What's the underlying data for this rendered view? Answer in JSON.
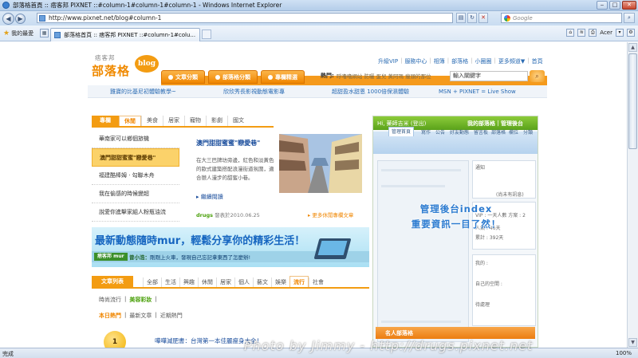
{
  "browser": {
    "title": "部落格首頁 :: 痞客邦 PIXNET ::#column-1#column-1#column-1 - Windows Internet Explorer",
    "url": "http://www.pixnet.net/blog#column-1",
    "search_placeholder": "Google",
    "favorites_label": "我的最愛",
    "tab_title": "部落格首頁 :: 痞客邦 PIXNET ::#column-1#colu...",
    "toolbar_account": "Acer",
    "status_text": "完成",
    "zoom": "100%"
  },
  "header": {
    "logo_small": "痞客邦",
    "logo_big": "部落格",
    "logo_bubble": "blog",
    "top_links": [
      "升級VIP",
      "服務中心",
      "相簿",
      "部落格",
      "小圈圈",
      "更多頻道▼",
      "首頁"
    ],
    "nav_tabs": [
      "文章分類",
      "部落格分類",
      "專欄精選"
    ],
    "hot_label": "熱門:",
    "hot_text": "呼嚕嚕網站 防曬 蛋兒 黃阿瑪 瘦頭的那位 藝人的女孩",
    "keyword_value": "輸入關鍵字"
  },
  "promo": [
    "雞寶的比基尼初體驗教學~",
    "欣欣秀長影視動態電影專",
    "超甜盈水甜恩 1000倍保濕體驗",
    "MSN + PIXNET = Live Show"
  ],
  "left": {
    "tabs": [
      "專欄",
      "休閒",
      "美食",
      "居家",
      "寵物",
      "影劇",
      "國文"
    ],
    "side_items": [
      "華南家可以鄉個旅機",
      "澳門甜甜蜜蜜\"戀愛巷\"",
      "福建酷棒姆 · 勾聯木舟",
      "我在偷感的時候變超",
      "說愛你進擊家組人粉瓶油流"
    ],
    "feature": {
      "title": "澳門甜甜蜜蜜\"戀愛巷\"",
      "desc": "在大三巴牌坊旁邊，紅色和淡黃色的歐式建築搭配浪漫街道氛圍，適合戀人漫步的甜蜜小巷。",
      "more": "繼續閱讀",
      "user": "drugs",
      "date": "發表於2010.06.25",
      "more_link": "更多休閒專欄文章"
    },
    "banner": {
      "headline": "最新動態隨時mur，輕鬆分享你的精彩生活！",
      "badge": "痞客邦 mur",
      "user": "曾小浩：",
      "text": "剛剛上火車，發現自己忘記拿東西了怎麼辦!"
    },
    "list_tabs": {
      "main": "文章列表",
      "items": [
        "全部",
        "生活",
        "興趣",
        "休閒",
        "居家",
        "個人",
        "藝文",
        "娛樂",
        "流行",
        "社會"
      ],
      "active": "流行"
    },
    "sub_tabs_1": [
      "時尚流行",
      "美容彩妝"
    ],
    "sub_tabs_2": [
      "本日熱門",
      "最新文章",
      "近期熱門"
    ],
    "rank": {
      "num": "1",
      "text": "嘩嘩減肥書：台灣第一本佳麗瘦身大全！"
    }
  },
  "right": {
    "hi_text": "Hi, 藥師吉米 (登出)",
    "my_blog": "我的部落格｜管理後台",
    "nav": [
      "管理首頁",
      "寫作",
      "公告",
      "好友動態",
      "留言板",
      "部落格",
      "欄位",
      "分類",
      "分享"
    ],
    "aside_labels": [
      "通知",
      "(尚未有訊息)",
      "VIP : 一天人數 方案 : 2",
      "人氣 : 46天",
      "累計 : 392天",
      "我的 :",
      "自己的空間 :",
      "待處理"
    ],
    "overlay_1": "管理後台index",
    "overlay_2": "重要資訊一目了然！",
    "famous_header": "名人部落格"
  },
  "watermark": "Photo by Jimmy - http://drugs.pixnet.net"
}
